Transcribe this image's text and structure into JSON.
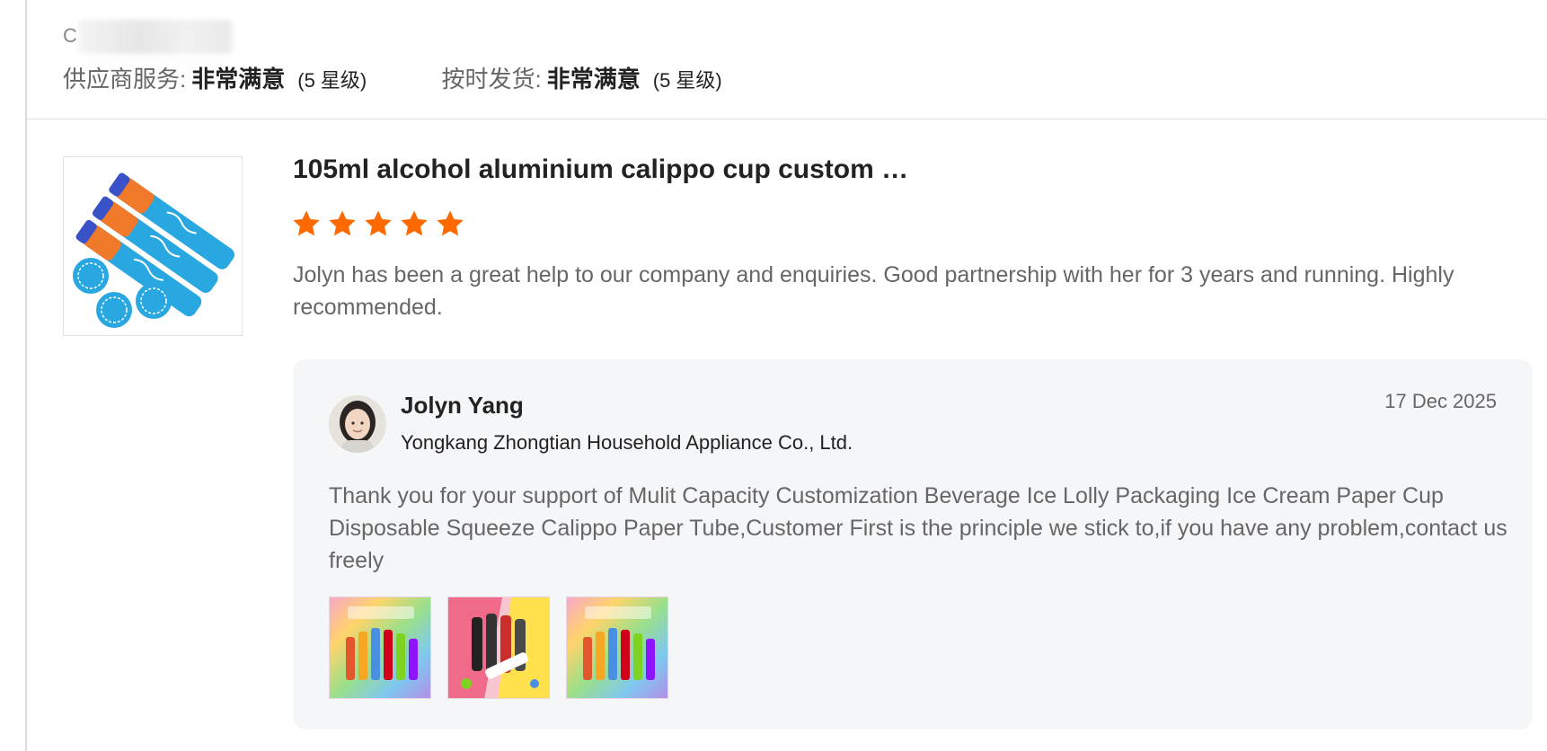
{
  "reviewer": {
    "name_prefix": "C"
  },
  "ratings": [
    {
      "label": "供应商服务:",
      "value": "非常满意",
      "stars": "(5 星级)"
    },
    {
      "label": "按时发货:",
      "value": "非常满意",
      "stars": "(5 星级)"
    }
  ],
  "product": {
    "title": "105ml alcohol aluminium calippo cup custom …",
    "rating": 5,
    "star_color": "#ff6a00",
    "image_icon": "calippo-tubes-image"
  },
  "review": {
    "text": "Jolyn has been a great help to our company and enquiries. Good partnership with her for 3 years and running. Highly recommended."
  },
  "reply": {
    "name": "Jolyn Yang",
    "company": "Yongkang Zhongtian Household Appliance Co., Ltd.",
    "date": "17 Dec 2025",
    "text": "Thank you for your support of Mulit Capacity Customization Beverage Ice Lolly Packaging Ice Cream Paper Cup Disposable Squeeze Calippo Paper Tube,Customer First is the principle we stick to,if you have any problem,contact us freely",
    "images": [
      "rainbow-collection-image",
      "colorful-tubes-image",
      "rainbow-collection-image"
    ]
  }
}
